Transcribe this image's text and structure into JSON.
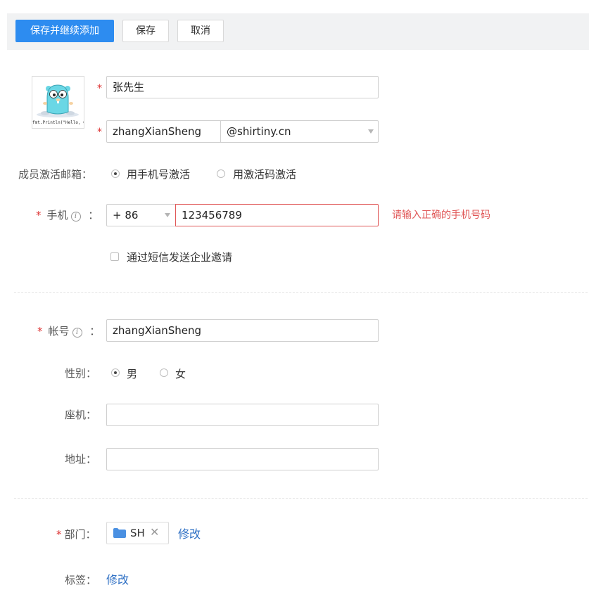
{
  "toolbar": {
    "save_continue_label": "保存并继续添加",
    "save_label": "保存",
    "cancel_label": "取消"
  },
  "avatar": {
    "caption": "fmt.Println(\"Hello, Golang!\")"
  },
  "name": {
    "value": "张先生"
  },
  "email": {
    "username": "zhangXianSheng",
    "domain": "@shirtiny.cn"
  },
  "activation": {
    "label": "成员激活邮箱：",
    "options": [
      "用手机号激活",
      "用激活码激活"
    ],
    "selected": 0
  },
  "phone": {
    "label": "手机",
    "colon": "：",
    "country_code": "+ 86",
    "value": "123456789",
    "error": "请输入正确的手机号码"
  },
  "sms_invite": {
    "label": "通过短信发送企业邀请",
    "checked": false
  },
  "account": {
    "label": "帐号",
    "colon": "：",
    "value": "zhangXianSheng"
  },
  "gender": {
    "label": "性别：",
    "options": [
      "男",
      "女"
    ],
    "selected": 0
  },
  "landline": {
    "label": "座机：",
    "value": ""
  },
  "address": {
    "label": "地址：",
    "value": ""
  },
  "department": {
    "label": "部门：",
    "tag": "SH",
    "edit_label": "修改"
  },
  "tags": {
    "label": "标签：",
    "edit_label": "修改"
  },
  "colors": {
    "primary": "#2d8cf0",
    "error": "#e05757",
    "required": "#dd3333",
    "link": "#2d6fc4",
    "folder": "#4a90e2"
  }
}
